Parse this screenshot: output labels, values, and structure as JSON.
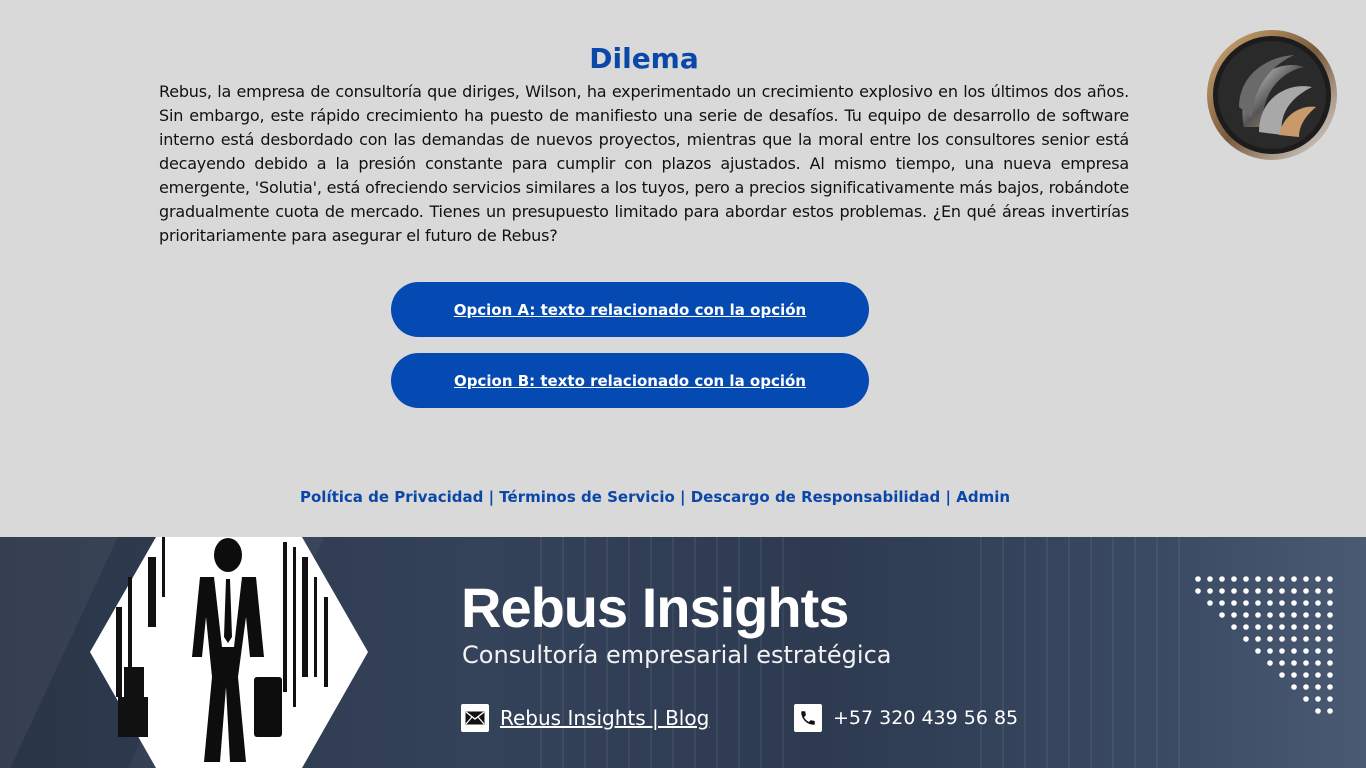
{
  "dilemma": {
    "title": "Dilema",
    "text": "Rebus, la empresa de consultoría que diriges, Wilson, ha experimentado un crecimiento explosivo en los últimos dos años. Sin embargo, este rápido crecimiento ha puesto de manifiesto una serie de desafíos. Tu equipo de desarrollo de software interno está desbordado con las demandas de nuevos proyectos, mientras que la moral entre los consultores senior está decayendo debido a la presión constante para cumplir con plazos ajustados. Al mismo tiempo, una nueva empresa emergente, 'Solutia', está ofreciendo servicios similares a los tuyos, pero a precios significativamente más bajos, robándote gradualmente cuota de mercado. Tienes un presupuesto limitado para abordar estos problemas. ¿En qué áreas invertirías prioritariamente para asegurar el futuro de Rebus?"
  },
  "options": {
    "a": "Opcion A: texto relacionado con la opción",
    "b": "Opcion B: texto relacionado con la opción"
  },
  "footer": {
    "privacy": "Política de Privacidad",
    "terms": "Términos de Servicio",
    "disclaimer": "Descargo de Responsabilidad",
    "admin": "Admin",
    "separator": "|"
  },
  "banner": {
    "title": "Rebus Insights",
    "subtitle": "Consultoría empresarial estratégica",
    "email_label": "Rebus Insights | Blog",
    "phone": "+57 320 439 56 85",
    "email_icon": "mail-icon",
    "phone_icon": "phone-icon"
  },
  "colors": {
    "accent": "#0a47a8",
    "button": "#054ab2",
    "background": "#d9d9d9",
    "banner": "#2d3a50"
  }
}
